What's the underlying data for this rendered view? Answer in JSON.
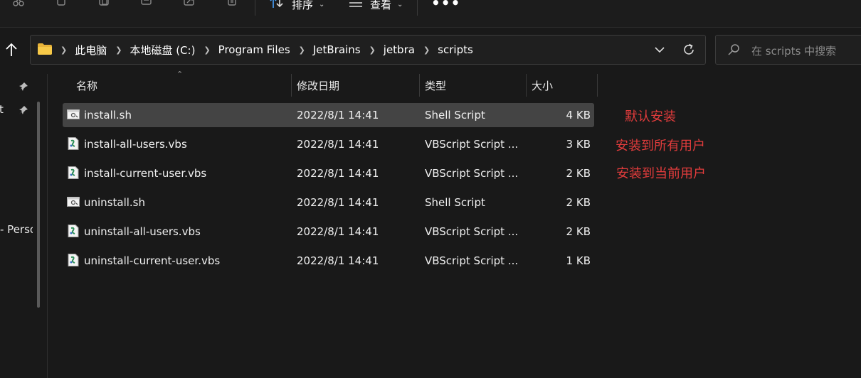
{
  "toolbar": {
    "sort_label": "排序",
    "view_label": "查看"
  },
  "address": {
    "crumbs": [
      "此电脑",
      "本地磁盘 (C:)",
      "Program Files",
      "JetBrains",
      "jetbra",
      "scripts"
    ]
  },
  "search": {
    "placeholder": "在 scripts 中搜索"
  },
  "nav": {
    "partial_items": [
      "t",
      "- Perso"
    ]
  },
  "columns": {
    "name": "名称",
    "date": "修改日期",
    "type": "类型",
    "size": "大小"
  },
  "files": [
    {
      "name": "install.sh",
      "date": "2022/8/1 14:41",
      "type": "Shell Script",
      "size": "4 KB",
      "icon": "shell-script-icon",
      "selected": true
    },
    {
      "name": "install-all-users.vbs",
      "date": "2022/8/1 14:41",
      "type": "VBScript Script ...",
      "size": "3 KB",
      "icon": "vbscript-icon"
    },
    {
      "name": "install-current-user.vbs",
      "date": "2022/8/1 14:41",
      "type": "VBScript Script ...",
      "size": "2 KB",
      "icon": "vbscript-icon"
    },
    {
      "name": "uninstall.sh",
      "date": "2022/8/1 14:41",
      "type": "Shell Script",
      "size": "2 KB",
      "icon": "shell-script-icon"
    },
    {
      "name": "uninstall-all-users.vbs",
      "date": "2022/8/1 14:41",
      "type": "VBScript Script ...",
      "size": "2 KB",
      "icon": "vbscript-icon"
    },
    {
      "name": "uninstall-current-user.vbs",
      "date": "2022/8/1 14:41",
      "type": "VBScript Script ...",
      "size": "1 KB",
      "icon": "vbscript-icon"
    }
  ],
  "annotations": [
    "默认安装",
    "安装到所有用户",
    "安装到当前用户"
  ],
  "colors": {
    "annotation": "#e23c3c",
    "selected_row": "#444444",
    "background": "#191919"
  }
}
